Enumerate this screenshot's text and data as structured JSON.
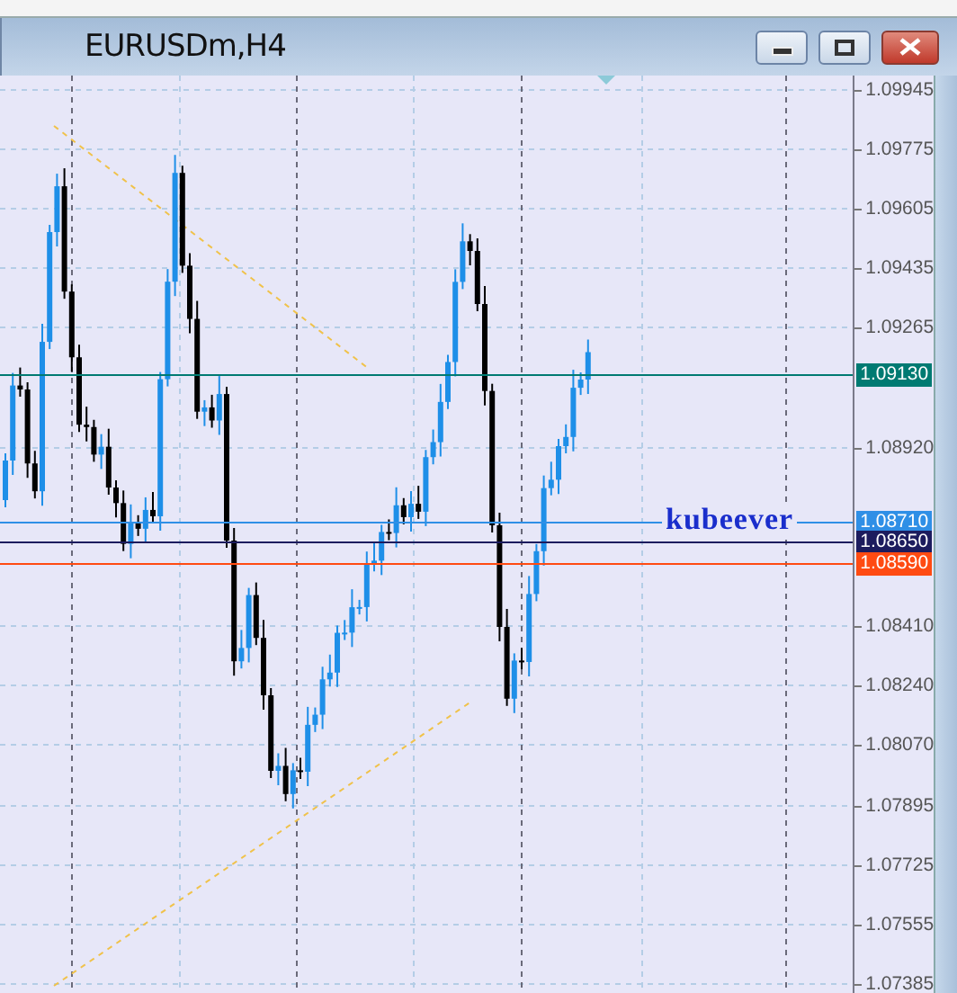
{
  "window": {
    "title": "EURUSDm,H4"
  },
  "price_axis": {
    "ticks": [
      "1.09945",
      "1.09775",
      "1.09605",
      "1.09435",
      "1.09265",
      "1.08920",
      "1.08410",
      "1.08240",
      "1.08070",
      "1.07895",
      "1.07725",
      "1.07555",
      "1.07385"
    ]
  },
  "price_lines": [
    {
      "label": "1.09130",
      "color": "#007a72"
    },
    {
      "label": "1.08710",
      "color": "#2f8fe6"
    },
    {
      "label": "1.08650",
      "color": "#1c1c5e"
    },
    {
      "label": "1.08590",
      "color": "#ff4b12"
    }
  ],
  "annotation": {
    "text": "kubeever"
  }
}
